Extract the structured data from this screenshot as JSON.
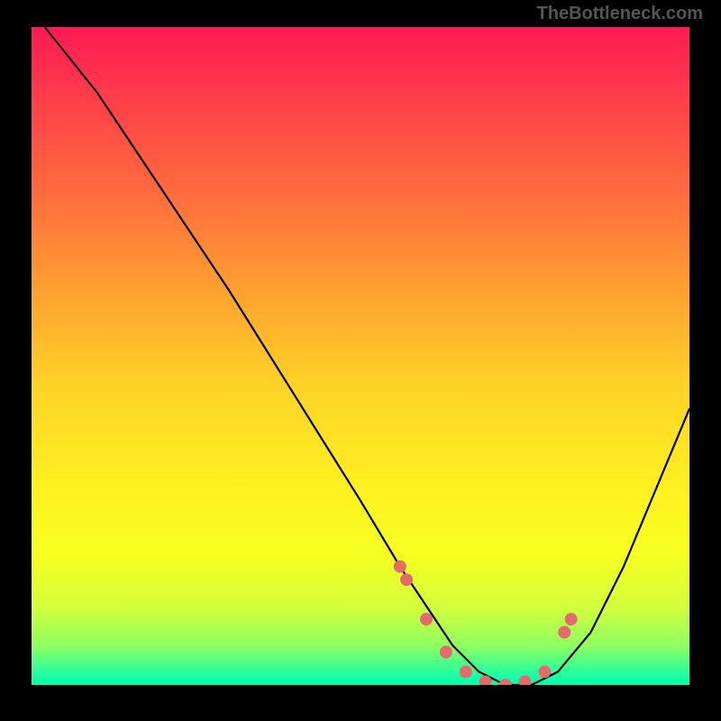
{
  "watermark": "TheBottleneck.com",
  "chart_data": {
    "type": "line",
    "title": "",
    "xlabel": "",
    "ylabel": "",
    "xlim": [
      0,
      100
    ],
    "ylim": [
      0,
      100
    ],
    "series": [
      {
        "name": "bottleneck-curve",
        "x": [
          2,
          10,
          20,
          30,
          40,
          50,
          56,
          60,
          64,
          68,
          72,
          76,
          80,
          85,
          90,
          95,
          100
        ],
        "y": [
          100,
          90,
          75,
          60,
          44,
          28,
          18,
          12,
          6,
          2,
          0,
          0,
          2,
          8,
          18,
          30,
          42
        ]
      }
    ],
    "markers": {
      "name": "highlight-points",
      "x": [
        56,
        57,
        60,
        63,
        66,
        69,
        72,
        75,
        78,
        81,
        82
      ],
      "y": [
        18,
        16,
        10,
        5,
        2,
        0.5,
        0,
        0.5,
        2,
        8,
        10
      ]
    },
    "colors": {
      "curve": "#000000",
      "markers": "#e56a6a"
    }
  }
}
